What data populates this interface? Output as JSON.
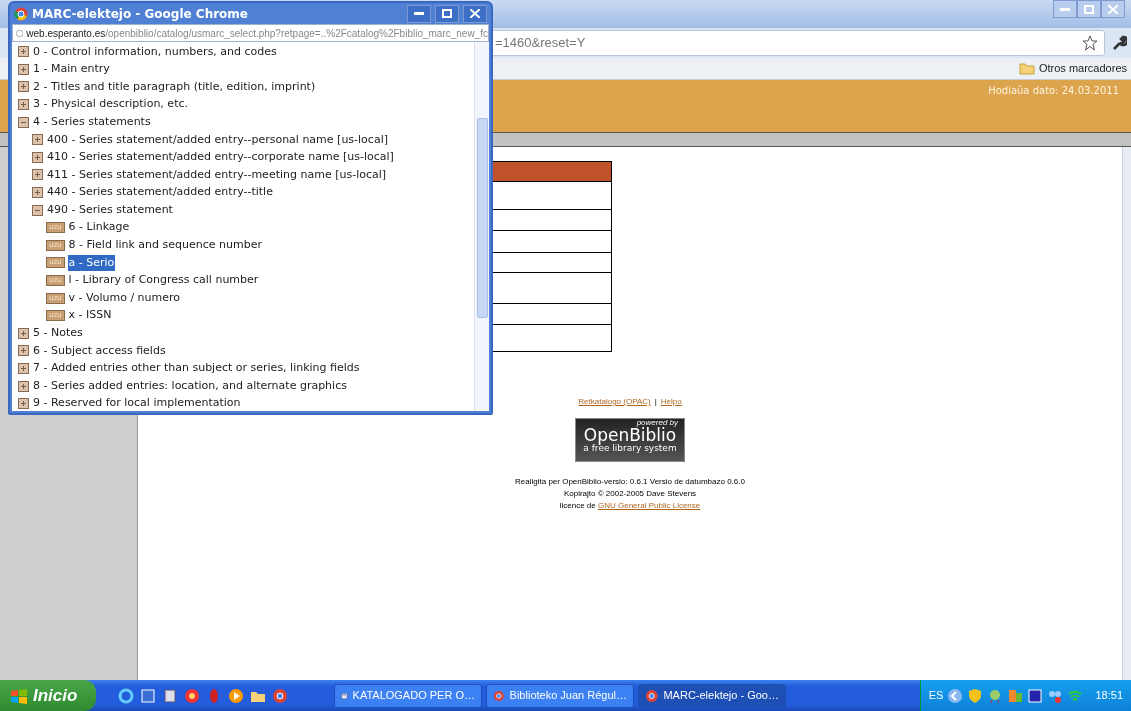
{
  "background_window": {
    "address_tail": "=1460&reset=Y",
    "bookmarks": [
      {
        "label": "Otros marcadores"
      }
    ],
    "page": {
      "date": "Hodiaŭa dato: 24.03.2011",
      "footer_links": [
        {
          "label": "Retkatalogo (OPAC)"
        },
        {
          "label": "Helpo"
        }
      ],
      "separator": "|",
      "logo": {
        "top": "powered by",
        "name": "OpenBiblio",
        "tagline": "a free library system"
      },
      "credits": [
        "Realigita per OpenBiblio-versio: 0.6.1 Versio de datumbazo 0.6.0",
        "Kopirajto © 2002-2005 Dave Stevens"
      ],
      "license": {
        "prefix": "licence de",
        "link": "GNU General Public License"
      }
    }
  },
  "popup": {
    "title": "MARC-elektejo - Google Chrome",
    "url_host": "web.esperanto.es",
    "url_path": "/openbiblio/catalog/usmarc_select.php?retpage=..%2Fcatalog%2Fbiblio_marc_new_fc",
    "tree": [
      {
        "kind": "field",
        "label": "0 - Control information, numbers, and codes",
        "expanded": false
      },
      {
        "kind": "field",
        "label": "1 - Main entry",
        "expanded": false
      },
      {
        "kind": "field",
        "label": "2 - Titles and title paragraph (title, edition, imprint)",
        "expanded": false
      },
      {
        "kind": "field",
        "label": "3 - Physical description, etc.",
        "expanded": false
      },
      {
        "kind": "field",
        "label": "4 - Series statements",
        "expanded": true,
        "children": [
          {
            "kind": "field",
            "label": "400 - Series statement/added entry--personal name [us-local]",
            "expanded": false
          },
          {
            "kind": "field",
            "label": "410 - Series statement/added entry--corporate name [us-local]",
            "expanded": false
          },
          {
            "kind": "field",
            "label": "411 - Series statement/added entry--meeting name [us-local]",
            "expanded": false
          },
          {
            "kind": "field",
            "label": "440 - Series statement/added entry--title",
            "expanded": false
          },
          {
            "kind": "field",
            "label": "490 - Series statement",
            "expanded": true,
            "children": [
              {
                "kind": "subfield",
                "button": "uzu",
                "label": "6 - Linkage",
                "selected": false
              },
              {
                "kind": "subfield",
                "button": "uzu",
                "label": "8 - Field link and sequence number",
                "selected": false
              },
              {
                "kind": "subfield",
                "button": "uzu",
                "label": "a - Serio",
                "selected": true
              },
              {
                "kind": "subfield",
                "button": "uzu",
                "label": "l - Library of Congress call number",
                "selected": false
              },
              {
                "kind": "subfield",
                "button": "uzu",
                "label": "v - Volumo / numero",
                "selected": false
              },
              {
                "kind": "subfield",
                "button": "uzu",
                "label": "x - ISSN",
                "selected": false
              }
            ]
          }
        ]
      },
      {
        "kind": "field",
        "label": "5 - Notes",
        "expanded": false
      },
      {
        "kind": "field",
        "label": "6 - Subject access fields",
        "expanded": false
      },
      {
        "kind": "field",
        "label": "7 - Added entries other than subject or series, linking fields",
        "expanded": false
      },
      {
        "kind": "field",
        "label": "8 - Series added entries: location, and alternate graphics",
        "expanded": false
      },
      {
        "kind": "field",
        "label": "9 - Reserved for local implementation",
        "expanded": false
      }
    ]
  },
  "taskbar": {
    "start": "Inicio",
    "tasks": [
      {
        "kind": "document",
        "label": "KATALOGADO PER O…",
        "selected": false
      },
      {
        "kind": "browser",
        "label": "Biblioteko Juan Régul…",
        "selected": false
      },
      {
        "kind": "browser",
        "label": "MARC-elektejo - Goo…",
        "selected": true
      }
    ],
    "language": "ES",
    "clock": "18:51"
  }
}
